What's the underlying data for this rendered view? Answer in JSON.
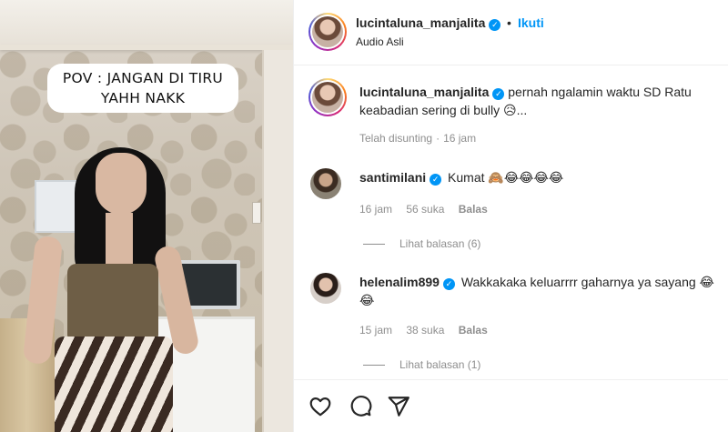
{
  "video": {
    "overlay_text": "POV : JANGAN DI TIRU\nYAHH NAKK"
  },
  "header": {
    "username": "lucintaluna_manjalita",
    "separator": "•",
    "follow_label": "Ikuti",
    "audio_label": "Audio Asli"
  },
  "caption": {
    "username": "lucintaluna_manjalita",
    "text": "pernah ngalamin waktu SD Ratu keabadian sering di bully 😥...",
    "edited_label": "Telah disunting",
    "time": "16 jam"
  },
  "comments": [
    {
      "username": "santimilani",
      "text": "Kumat 🙈😂😂😂😂",
      "time": "16 jam",
      "likes": "56 suka",
      "reply_label": "Balas",
      "view_replies": "Lihat balasan (6)"
    },
    {
      "username": "helenalim899",
      "text": "Wakkakaka keluarrrr gaharnya ya sayang 😂😂",
      "time": "15 jam",
      "likes": "38 suka",
      "reply_label": "Balas",
      "view_replies": "Lihat balasan (1)"
    }
  ],
  "icons": {
    "verified": "verified-badge-icon",
    "like": "heart-icon",
    "comment": "comment-icon",
    "share": "paper-plane-icon"
  },
  "colors": {
    "accent": "#0095f6",
    "muted": "#8e8e8e",
    "text": "#262626"
  }
}
